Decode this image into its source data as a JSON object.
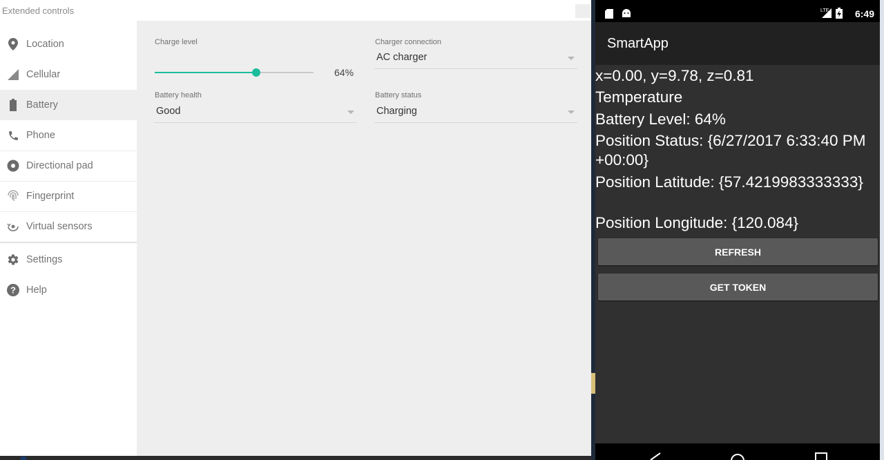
{
  "extended_controls": {
    "title": "Extended controls",
    "nav": [
      {
        "label": "Location",
        "icon": "location-pin-icon"
      },
      {
        "label": "Cellular",
        "icon": "cellular-signal-icon"
      },
      {
        "label": "Battery",
        "icon": "battery-icon"
      },
      {
        "label": "Phone",
        "icon": "phone-icon"
      },
      {
        "label": "Directional pad",
        "icon": "dpad-icon"
      },
      {
        "label": "Fingerprint",
        "icon": "fingerprint-icon"
      },
      {
        "label": "Virtual sensors",
        "icon": "rotation-icon"
      },
      {
        "label": "Settings",
        "icon": "gear-icon"
      },
      {
        "label": "Help",
        "icon": "help-icon"
      }
    ],
    "active_nav": "Battery",
    "battery": {
      "charge_level_label": "Charge level",
      "charge_level_value": 64,
      "charge_level_text": "64%",
      "charger_connection_label": "Charger connection",
      "charger_connection_value": "AC charger",
      "battery_health_label": "Battery health",
      "battery_health_value": "Good",
      "battery_status_label": "Battery status",
      "battery_status_value": "Charging"
    },
    "accent_color": "#1abc9c"
  },
  "phone": {
    "status_time": "6:49",
    "status_lte": "LTE",
    "app_title": "SmartApp",
    "lines": [
      "x=0.00, y=9.78, z=0.81",
      "Temperature",
      "Battery Level: 64%",
      "Position Status: {6/27/2017 6:33:40 PM +00:00}",
      "Position Latitude: {57.4219983333333}",
      "Position Longitude: {120.084}"
    ],
    "refresh_label": "REFRESH",
    "get_token_label": "GET TOKEN"
  }
}
